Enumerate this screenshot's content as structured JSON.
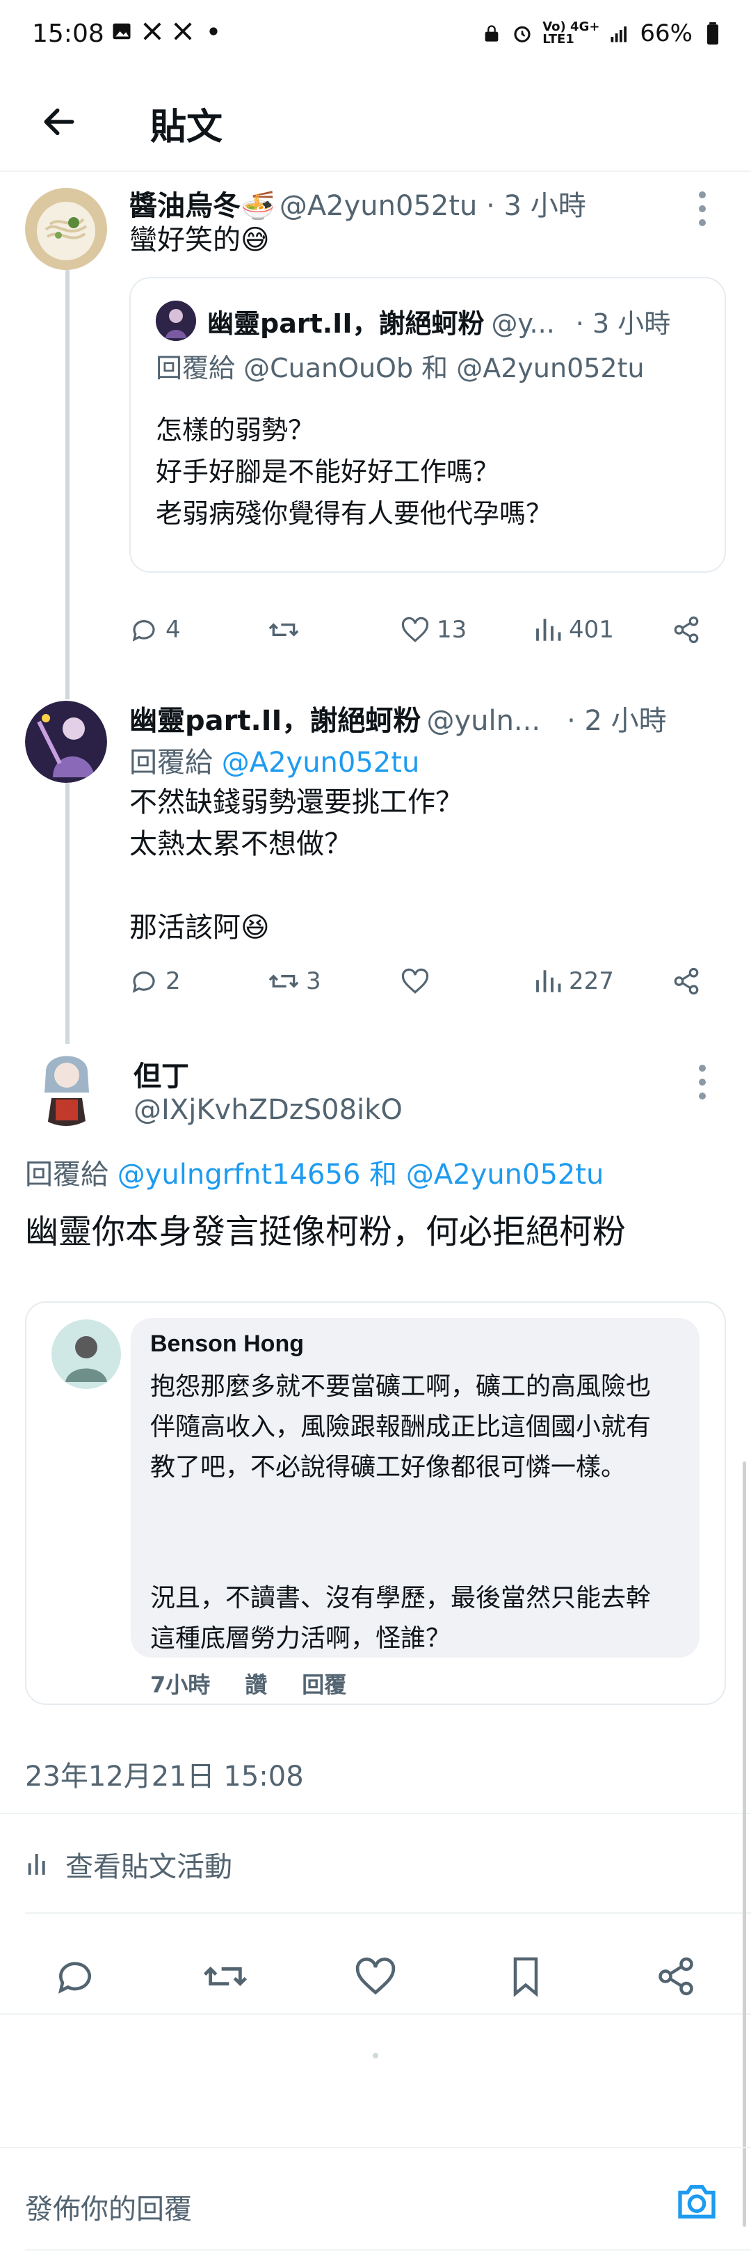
{
  "status_bar": {
    "time": "15:08",
    "battery": "66%",
    "network": "Vo) 4G+\nLTE1"
  },
  "header": {
    "title": "貼文"
  },
  "tweet1": {
    "name": "醬油烏冬🍜",
    "handle": "@A2yun052tu · 3 小時",
    "text": "蠻好笑的😅",
    "quote": {
      "name": "幽靈part.II，謝絕蚵粉",
      "handle": "@y...",
      "time": "· 3 小時",
      "reply_to": "回覆給 @CuanOuOb 和 @A2yun052tu",
      "line1": "怎樣的弱勢？",
      "line2": "好手好腳是不能好好工作嗎？",
      "line3": "老弱病殘你覺得有人要他代孕嗎？"
    },
    "stats": {
      "replies": "4",
      "likes": "13",
      "views": "401"
    }
  },
  "tweet2": {
    "name": "幽靈part.II，謝絕蚵粉",
    "handle": "@yuln...",
    "time": "· 2 小時",
    "reply_to_prefix": "回覆給 ",
    "reply_to_user": "@A2yun052tu",
    "line1": "不然缺錢弱勢還要挑工作？",
    "line2": "太熱太累不想做？",
    "line3": "那活該阿😆",
    "stats": {
      "replies": "2",
      "retweets": "3",
      "views": "227"
    }
  },
  "main_tweet": {
    "name": "但丁",
    "handle": "@IXjKvhZDzS08ikO",
    "reply_prefix": "回覆給 ",
    "reply_users": "@yulngrfnt14656 和 @A2yun052tu",
    "text": "幽靈你本身發言挺像柯粉，何必拒絕柯粉",
    "image": {
      "commenter": "Benson Hong",
      "para1": "抱怨那麼多就不要當礦工啊，礦工的高風險也伴隨高收入，風險跟報酬成正比這個國小就有教了吧，不必說得礦工好像都很可憐一樣。",
      "para2": "況且，不讀書、沒有學歷，最後當然只能去幹這種底層勞力活啊，怪誰？",
      "meta_time": "7小時",
      "meta_like": "讚",
      "meta_reply": "回覆"
    },
    "timestamp": "23年12月21日 15:08",
    "activity": "查看貼文活動"
  },
  "reply_bar": {
    "placeholder": "發佈你的回覆"
  },
  "colors": {
    "accent": "#1d9bf0",
    "muted": "#536471",
    "divider": "#eff3f4"
  }
}
